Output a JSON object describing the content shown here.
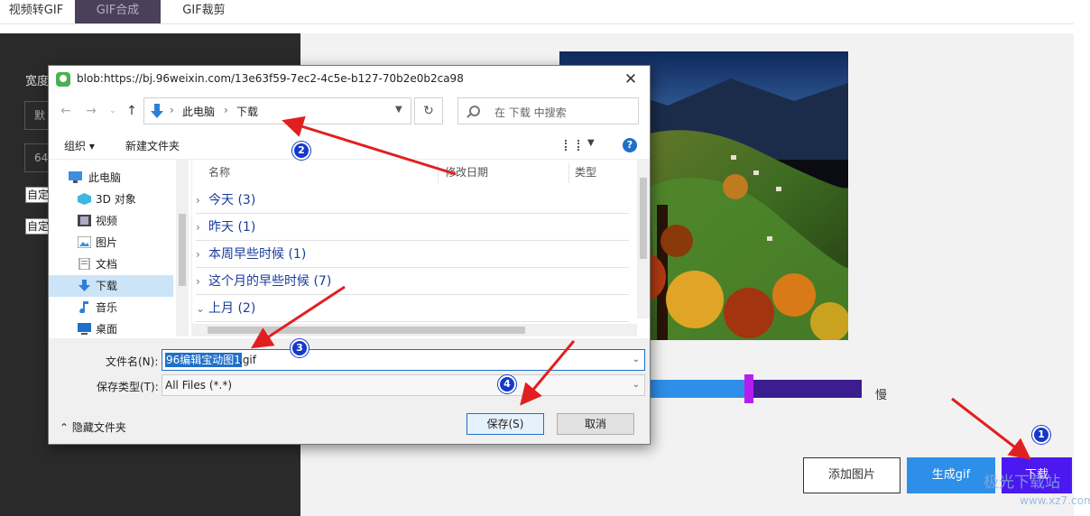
{
  "top_tabs": [
    "视频转GIF",
    "GIF合成",
    "GIF裁剪"
  ],
  "left_panel": {
    "width_label": "宽度",
    "box1": "默",
    "box2": "64",
    "check1": "自定",
    "check2": "自定"
  },
  "speed_label": "慢",
  "buttons": {
    "add_image": "添加图片",
    "generate": "生成gif",
    "download": "下载"
  },
  "dialog": {
    "title": "blob:https://bj.96weixin.com/13e63f59-7ec2-4c5e-b127-70b2e0b2ca98",
    "close": "✕",
    "breadcrumb": [
      "此电脑",
      "下载"
    ],
    "search_placeholder": "在 下载 中搜索",
    "toolbar": {
      "organize": "组织 ▾",
      "new_folder": "新建文件夹"
    },
    "nav_items": [
      {
        "label": "此电脑",
        "icon": "computer-icon"
      },
      {
        "label": "3D 对象",
        "icon": "3d-objects-icon"
      },
      {
        "label": "视频",
        "icon": "video-icon"
      },
      {
        "label": "图片",
        "icon": "picture-icon"
      },
      {
        "label": "文档",
        "icon": "document-icon"
      },
      {
        "label": "下载",
        "icon": "download-icon"
      },
      {
        "label": "音乐",
        "icon": "music-icon"
      },
      {
        "label": "桌面",
        "icon": "desktop-icon"
      }
    ],
    "columns": [
      "名称",
      "修改日期",
      "类型"
    ],
    "groups": [
      "今天 (3)",
      "昨天 (1)",
      "本周早些时候 (1)",
      "这个月的早些时候 (7)",
      "上月 (2)"
    ],
    "filename_label": "文件名(N):",
    "filename_selected": "96编辑宝动图1",
    "filename_ext": ".gif",
    "filetype_label": "保存类型(T):",
    "filetype_value": "All Files (*.*)",
    "hide_folders": "隐藏文件夹",
    "save": "保存(S)",
    "cancel": "取消"
  },
  "annotations": [
    "1",
    "2",
    "3",
    "4"
  ],
  "watermark": {
    "main": "极光下载站",
    "url": "www.xz7.com"
  },
  "colors": {
    "annotation_arrow": "#e02020",
    "badge": "#1539c9",
    "download_button": "#4b19f0",
    "generate_button": "#2e8fe9",
    "speed_slow": "#3b1d8f",
    "speed_thumb": "#b51ef0"
  }
}
